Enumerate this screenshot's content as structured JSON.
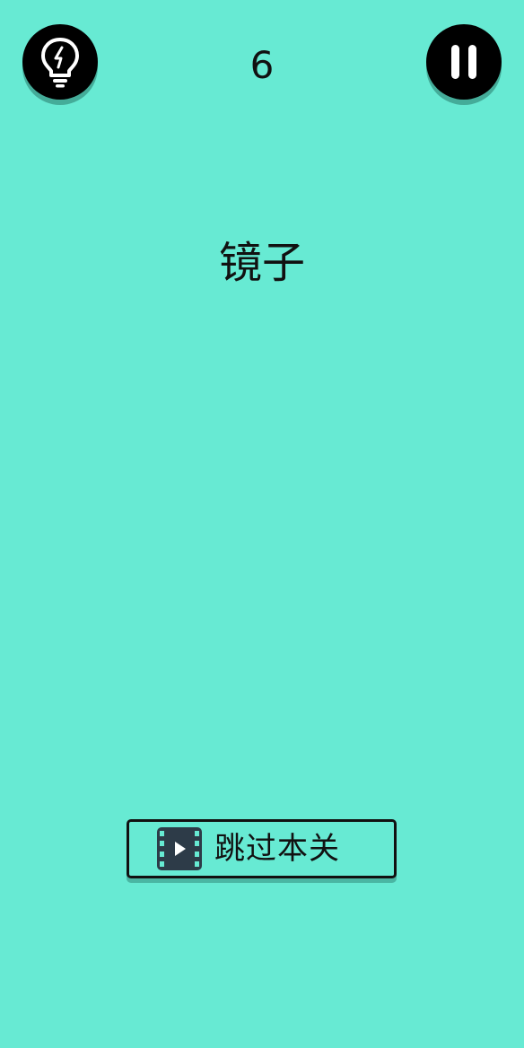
{
  "game": {
    "level_number": "6",
    "puzzle_word": "镜子"
  },
  "buttons": {
    "hint_icon": "lightbulb-icon",
    "pause_icon": "pause-icon",
    "skip_label": "跳过本关",
    "skip_icon": "video-play-icon"
  },
  "colors": {
    "background": "#67ead3",
    "button_fill": "#000000",
    "text": "#111111",
    "video_icon_fill": "#2d3b48"
  }
}
